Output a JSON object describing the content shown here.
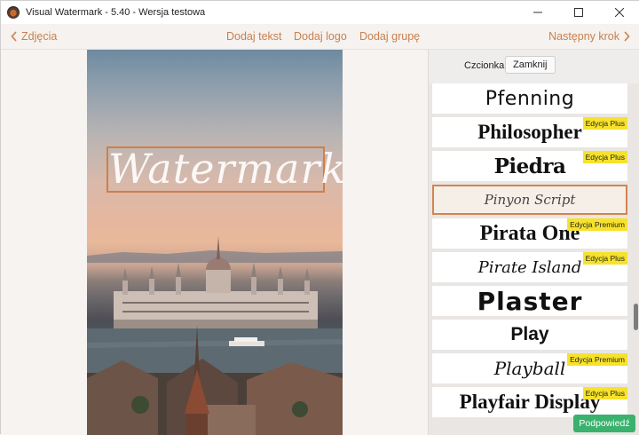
{
  "window": {
    "title": "Visual Watermark - 5.40 - Wersja testowa"
  },
  "toolbar": {
    "back_label": "Zdjęcia",
    "add_text_label": "Dodaj tekst",
    "add_logo_label": "Dodaj logo",
    "add_group_label": "Dodaj grupę",
    "next_label": "Następny krok"
  },
  "canvas": {
    "watermark_text": "Watermark"
  },
  "panel": {
    "font_label": "Czcionka",
    "close_label": "Zamknij",
    "hint_label": "Podpowiedź",
    "fonts": [
      {
        "name": "Pfenning",
        "badge": ""
      },
      {
        "name": "Philosopher",
        "badge": "Edycja Plus"
      },
      {
        "name": "Piedra",
        "badge": "Edycja Plus"
      },
      {
        "name": "Pinyon Script",
        "badge": ""
      },
      {
        "name": "Pirata One",
        "badge": "Edycja Premium"
      },
      {
        "name": "Pirate Island",
        "badge": "Edycja Plus"
      },
      {
        "name": "Plaster",
        "badge": ""
      },
      {
        "name": "Play",
        "badge": ""
      },
      {
        "name": "Playball",
        "badge": "Edycja Premium"
      },
      {
        "name": "Playfair Display",
        "badge": "Edycja Plus"
      }
    ],
    "selected_font": "Pinyon Script"
  },
  "colors": {
    "accent": "#c9804e",
    "selection_border": "#d4844f",
    "badge": "#f7e22b",
    "hint_button": "#3bb16e"
  }
}
